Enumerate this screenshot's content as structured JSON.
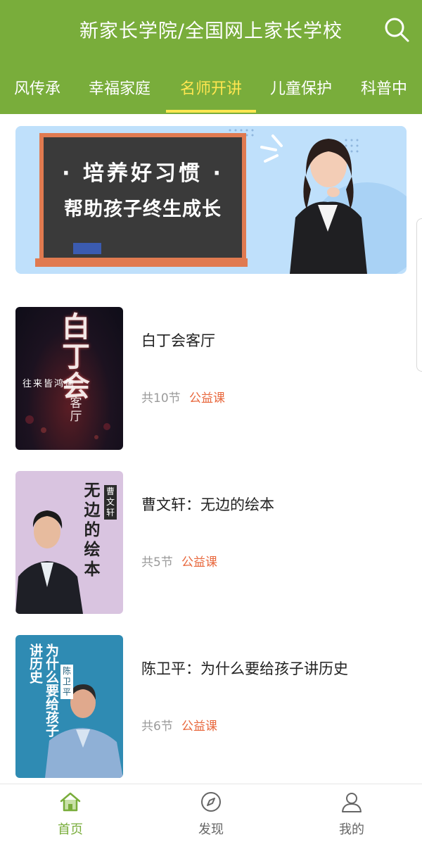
{
  "header": {
    "title": "新家长学院/全国网上家长学校",
    "search_icon": "search-icon"
  },
  "tabs": [
    {
      "label": "风传承",
      "active": false
    },
    {
      "label": "幸福家庭",
      "active": false
    },
    {
      "label": "名师开讲",
      "active": true
    },
    {
      "label": "儿童保护",
      "active": false
    },
    {
      "label": "科普中",
      "active": false
    }
  ],
  "banner": {
    "line1": "· 培养好习惯 ·",
    "line2": "帮助孩子终生成长"
  },
  "courses": [
    {
      "title": "白丁会客厅",
      "count": "共10节",
      "tag": "公益课",
      "cover": {
        "big": "白丁会",
        "sub": "客厅",
        "side": "往来皆鸿儒"
      }
    },
    {
      "title": "曹文轩：无边的绘本",
      "count": "共5节",
      "tag": "公益课",
      "cover": {
        "big": "无边的绘本",
        "name": "曹文轩"
      }
    },
    {
      "title": "陈卫平：为什么要给孩子讲历史",
      "count": "共6节",
      "tag": "公益课",
      "cover": {
        "big": "为什么要给孩子讲历史",
        "name": "陈卫平"
      }
    }
  ],
  "nav": [
    {
      "label": "首页",
      "icon": "home-icon",
      "active": true
    },
    {
      "label": "发现",
      "icon": "compass-icon",
      "active": false
    },
    {
      "label": "我的",
      "icon": "user-icon",
      "active": false
    }
  ],
  "colors": {
    "brand": "#79ad3b",
    "active_tab": "#ffe650",
    "tag": "#e8673c"
  }
}
